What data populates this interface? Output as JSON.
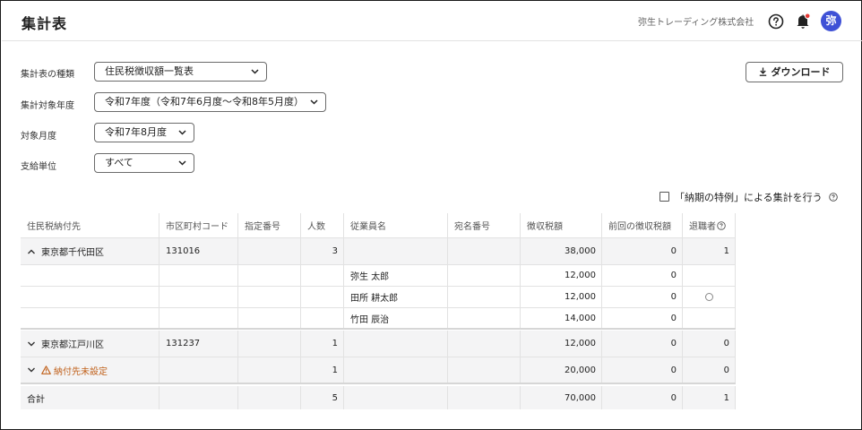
{
  "header": {
    "title": "集計表",
    "company": "弥生トレーディング株式会社",
    "avatar": "弥"
  },
  "filters": [
    {
      "label": "集計表の種類",
      "value": "住民税徴収額一覧表"
    },
    {
      "label": "集計対象年度",
      "value": "令和7年度（令和7年6月度〜令和8年5月度）"
    },
    {
      "label": "対象月度",
      "value": "令和7年8月度"
    },
    {
      "label": "支給単位",
      "value": "すべて"
    }
  ],
  "download_label": "ダウンロード",
  "special_option_label": "「納期の特例」による集計を行う",
  "table": {
    "columns": [
      "住民税納付先",
      "市区町村コード",
      "指定番号",
      "人数",
      "従業員名",
      "宛名番号",
      "徴収税額",
      "前回の徴収税額",
      "退職者"
    ],
    "rows": [
      {
        "place": "東京都千代田区",
        "code": "131016",
        "num": "",
        "count": "3",
        "emp": "",
        "addr": "",
        "tax": "38,000",
        "prev": "0",
        "ret": "1"
      },
      {
        "place": "",
        "code": "",
        "num": "",
        "count": "",
        "emp": "弥生 太郎",
        "addr": "",
        "tax": "12,000",
        "prev": "0",
        "ret": ""
      },
      {
        "place": "",
        "code": "",
        "num": "",
        "count": "",
        "emp": "田所 耕太郎",
        "addr": "",
        "tax": "12,000",
        "prev": "0",
        "ret": ""
      },
      {
        "place": "",
        "code": "",
        "num": "",
        "count": "",
        "emp": "竹田 辰治",
        "addr": "",
        "tax": "14,000",
        "prev": "0",
        "ret": ""
      },
      {
        "place": "東京都江戸川区",
        "code": "131237",
        "num": "",
        "count": "1",
        "emp": "",
        "addr": "",
        "tax": "12,000",
        "prev": "0",
        "ret": "0"
      },
      {
        "place": "納付先未設定",
        "code": "",
        "num": "",
        "count": "1",
        "emp": "",
        "addr": "",
        "tax": "20,000",
        "prev": "0",
        "ret": "0"
      },
      {
        "place": "合計",
        "code": "",
        "num": "",
        "count": "5",
        "emp": "",
        "addr": "",
        "tax": "70,000",
        "prev": "0",
        "ret": "1"
      }
    ]
  },
  "colors": {
    "accent": "#3f51d6",
    "warning": "#c0601a",
    "notification_dot": "#e53935"
  }
}
